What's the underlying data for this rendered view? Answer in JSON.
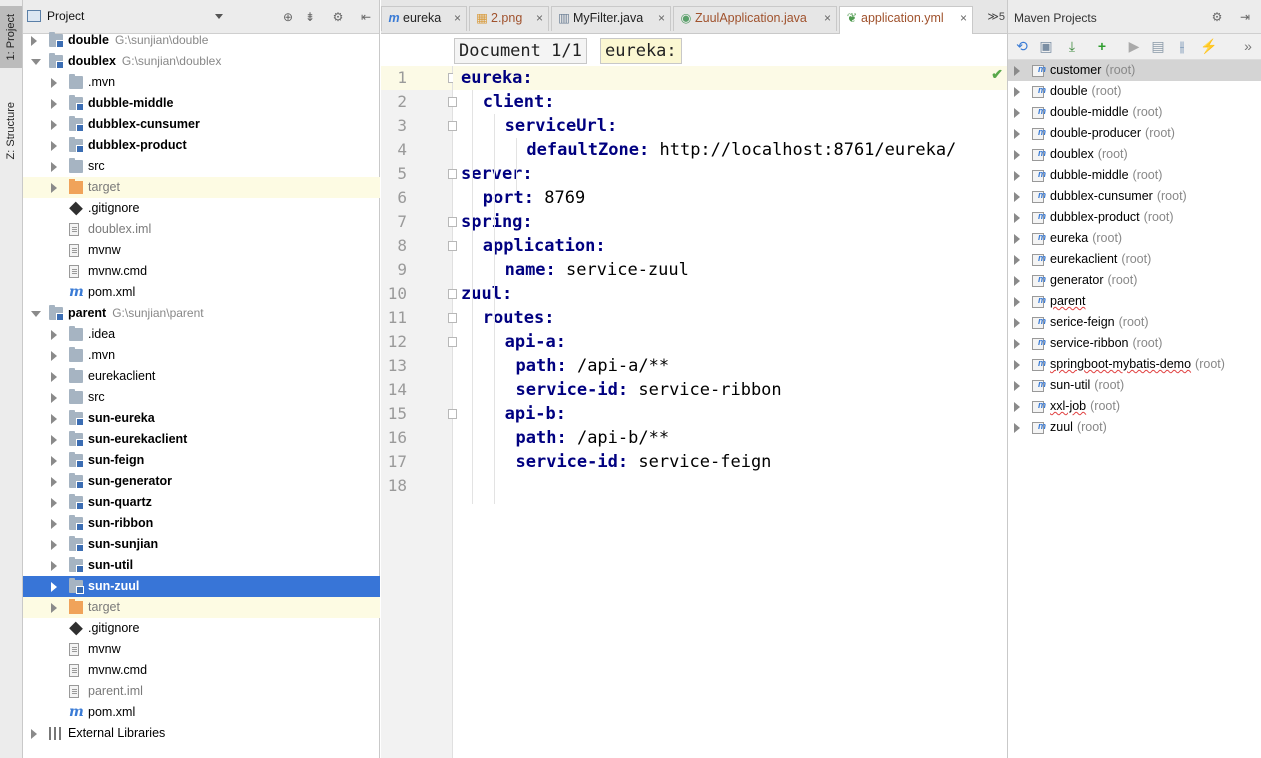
{
  "colors": {
    "selection": "#3875d7",
    "target_highlight": "#fdfbe3",
    "yaml_key": "#000080",
    "ok_check": "#59a84b"
  },
  "tool_strip": {
    "project_tab": "1: Project",
    "structure_tab": "Z: Structure"
  },
  "project_panel": {
    "title": "Project",
    "tree": [
      {
        "label": "double",
        "path": "G:\\sunjian\\double",
        "icon": "module-icon",
        "indent": 0,
        "expanded": false,
        "bold": true
      },
      {
        "label": "doublex",
        "path": "G:\\sunjian\\doublex",
        "icon": "module-icon",
        "indent": 0,
        "expanded": true,
        "bold": true
      },
      {
        "label": ".mvn",
        "icon": "folder-icon",
        "indent": 1,
        "expanded": false
      },
      {
        "label": "dubble-middle",
        "icon": "module-icon",
        "indent": 1,
        "expanded": false,
        "bold": true
      },
      {
        "label": "dubblex-cunsumer",
        "icon": "module-icon",
        "indent": 1,
        "expanded": false,
        "bold": true
      },
      {
        "label": "dubblex-product",
        "icon": "module-icon",
        "indent": 1,
        "expanded": false,
        "bold": true
      },
      {
        "label": "src",
        "icon": "folder-icon",
        "indent": 1,
        "expanded": false
      },
      {
        "label": "target",
        "icon": "target-folder-icon",
        "indent": 1,
        "expanded": false,
        "dim": true,
        "highlight": true
      },
      {
        "label": ".gitignore",
        "icon": "git-icon",
        "indent": 1,
        "leaf": true
      },
      {
        "label": "doublex.iml",
        "icon": "file-icon",
        "indent": 1,
        "leaf": true,
        "dim": true
      },
      {
        "label": "mvnw",
        "icon": "file-icon",
        "indent": 1,
        "leaf": true
      },
      {
        "label": "mvnw.cmd",
        "icon": "file-icon",
        "indent": 1,
        "leaf": true
      },
      {
        "label": "pom.xml",
        "icon": "maven-m-icon",
        "indent": 1,
        "leaf": true
      },
      {
        "label": "parent",
        "path": "G:\\sunjian\\parent",
        "icon": "module-icon",
        "indent": 0,
        "expanded": true,
        "bold": true
      },
      {
        "label": ".idea",
        "icon": "folder-icon",
        "indent": 1,
        "expanded": false
      },
      {
        "label": ".mvn",
        "icon": "folder-icon",
        "indent": 1,
        "expanded": false
      },
      {
        "label": "eurekaclient",
        "icon": "folder-icon",
        "indent": 1,
        "expanded": false
      },
      {
        "label": "src",
        "icon": "folder-icon",
        "indent": 1,
        "expanded": false
      },
      {
        "label": "sun-eureka",
        "icon": "module-icon",
        "indent": 1,
        "expanded": false,
        "bold": true
      },
      {
        "label": "sun-eurekaclient",
        "icon": "module-icon",
        "indent": 1,
        "expanded": false,
        "bold": true
      },
      {
        "label": "sun-feign",
        "icon": "module-icon",
        "indent": 1,
        "expanded": false,
        "bold": true
      },
      {
        "label": "sun-generator",
        "icon": "module-icon",
        "indent": 1,
        "expanded": false,
        "bold": true
      },
      {
        "label": "sun-quartz",
        "icon": "module-icon",
        "indent": 1,
        "expanded": false,
        "bold": true
      },
      {
        "label": "sun-ribbon",
        "icon": "module-icon",
        "indent": 1,
        "expanded": false,
        "bold": true
      },
      {
        "label": "sun-sunjian",
        "icon": "module-icon",
        "indent": 1,
        "expanded": false,
        "bold": true
      },
      {
        "label": "sun-util",
        "icon": "module-icon",
        "indent": 1,
        "expanded": false,
        "bold": true
      },
      {
        "label": "sun-zuul",
        "icon": "module-icon",
        "indent": 1,
        "expanded": false,
        "bold": true,
        "selected": true
      },
      {
        "label": "target",
        "icon": "target-folder-icon",
        "indent": 1,
        "expanded": false,
        "dim": true,
        "highlight": true
      },
      {
        "label": ".gitignore",
        "icon": "git-icon",
        "indent": 1,
        "leaf": true
      },
      {
        "label": "mvnw",
        "icon": "file-icon",
        "indent": 1,
        "leaf": true
      },
      {
        "label": "mvnw.cmd",
        "icon": "file-icon",
        "indent": 1,
        "leaf": true
      },
      {
        "label": "parent.iml",
        "icon": "file-icon",
        "indent": 1,
        "leaf": true,
        "dim": true
      },
      {
        "label": "pom.xml",
        "icon": "maven-m-icon",
        "indent": 1,
        "leaf": true
      },
      {
        "label": "External Libraries",
        "icon": "library-icon",
        "indent": 0,
        "expanded": false
      }
    ]
  },
  "editor": {
    "tabs": [
      {
        "label": "eureka",
        "icon": "maven-m-icon",
        "active": false
      },
      {
        "label": "2.png",
        "icon": "image-icon",
        "active": false
      },
      {
        "label": "MyFilter.java",
        "icon": "java-class-icon",
        "active": false
      },
      {
        "label": "ZuulApplication.java",
        "icon": "spring-class-icon",
        "active": false
      },
      {
        "label": "application.yml",
        "icon": "spring-leaf-icon",
        "active": true
      }
    ],
    "tab_overflow": "≫5",
    "breadcrumb": {
      "document": "Document 1/1",
      "key": "eureka:"
    },
    "lines": [
      {
        "n": "1",
        "indent": 0,
        "key": "eureka",
        "value": ""
      },
      {
        "n": "2",
        "indent": 1,
        "key": "client",
        "value": ""
      },
      {
        "n": "3",
        "indent": 2,
        "key": "serviceUrl",
        "value": ""
      },
      {
        "n": "4",
        "indent": 3,
        "key": "defaultZone",
        "value": "http://localhost:8761/eureka/"
      },
      {
        "n": "5",
        "indent": 0,
        "key": "server",
        "value": ""
      },
      {
        "n": "6",
        "indent": 1,
        "key": "port",
        "value": "8769"
      },
      {
        "n": "7",
        "indent": 0,
        "key": "spring",
        "value": ""
      },
      {
        "n": "8",
        "indent": 1,
        "key": "application",
        "value": ""
      },
      {
        "n": "9",
        "indent": 2,
        "key": "name",
        "value": "service-zuul"
      },
      {
        "n": "10",
        "indent": 0,
        "key": "zuul",
        "value": ""
      },
      {
        "n": "11",
        "indent": 1,
        "key": "routes",
        "value": ""
      },
      {
        "n": "12",
        "indent": 2,
        "key": "api-a",
        "value": ""
      },
      {
        "n": "13",
        "indent": 2.5,
        "key": "path",
        "value": "/api-a/**"
      },
      {
        "n": "14",
        "indent": 2.5,
        "key": "service-id",
        "value": "service-ribbon"
      },
      {
        "n": "15",
        "indent": 2,
        "key": "api-b",
        "value": ""
      },
      {
        "n": "16",
        "indent": 2.5,
        "key": "path",
        "value": "/api-b/**"
      },
      {
        "n": "17",
        "indent": 2.5,
        "key": "service-id",
        "value": "service-feign"
      },
      {
        "n": "18",
        "indent": 0,
        "key": "",
        "value": ""
      }
    ]
  },
  "maven_panel": {
    "title": "Maven Projects",
    "root_suffix": "(root)",
    "projects": [
      {
        "label": "customer",
        "root": true,
        "selected": true
      },
      {
        "label": "double",
        "root": true
      },
      {
        "label": "double-middle",
        "root": true
      },
      {
        "label": "double-producer",
        "root": true
      },
      {
        "label": "doublex",
        "root": true
      },
      {
        "label": "dubble-middle",
        "root": true
      },
      {
        "label": "dubblex-cunsumer",
        "root": true
      },
      {
        "label": "dubblex-product",
        "root": true
      },
      {
        "label": "eureka",
        "root": true
      },
      {
        "label": "eurekaclient",
        "root": true
      },
      {
        "label": "generator",
        "root": true
      },
      {
        "label": "parent",
        "root": false,
        "squiggle": true
      },
      {
        "label": "serice-feign",
        "root": true
      },
      {
        "label": "service-ribbon",
        "root": true
      },
      {
        "label": "springboot-mybatis-demo",
        "root": true,
        "squiggle": true
      },
      {
        "label": "sun-util",
        "root": true
      },
      {
        "label": "xxl-job",
        "root": true,
        "squiggle": true
      },
      {
        "label": "zuul",
        "root": true
      }
    ]
  }
}
